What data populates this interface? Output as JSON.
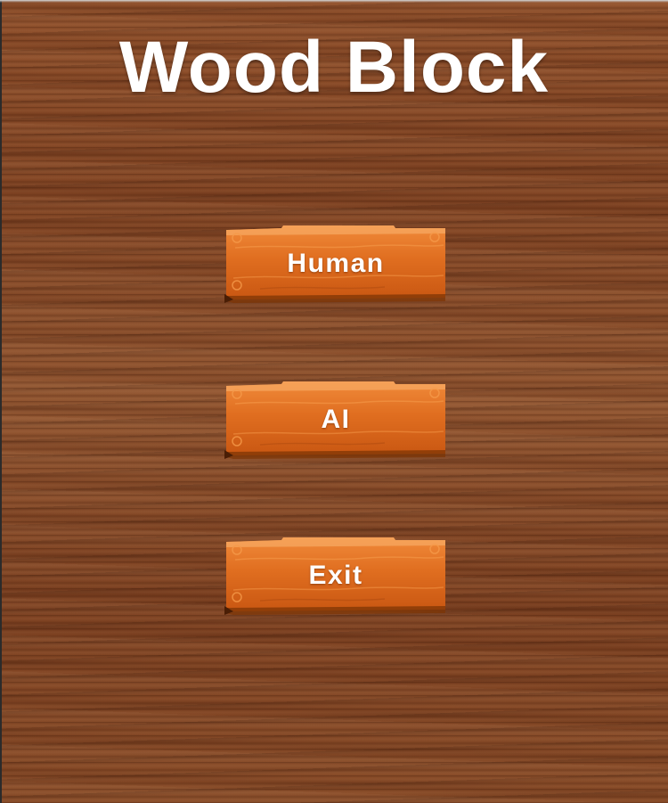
{
  "title": "Wood Block",
  "menu": {
    "human_label": "Human",
    "ai_label": "AI",
    "exit_label": "Exit"
  },
  "colors": {
    "background_wood": "#8a4a26",
    "button_orange": "#d9641a",
    "button_highlight": "#f59a4a",
    "text": "#ffffff"
  }
}
